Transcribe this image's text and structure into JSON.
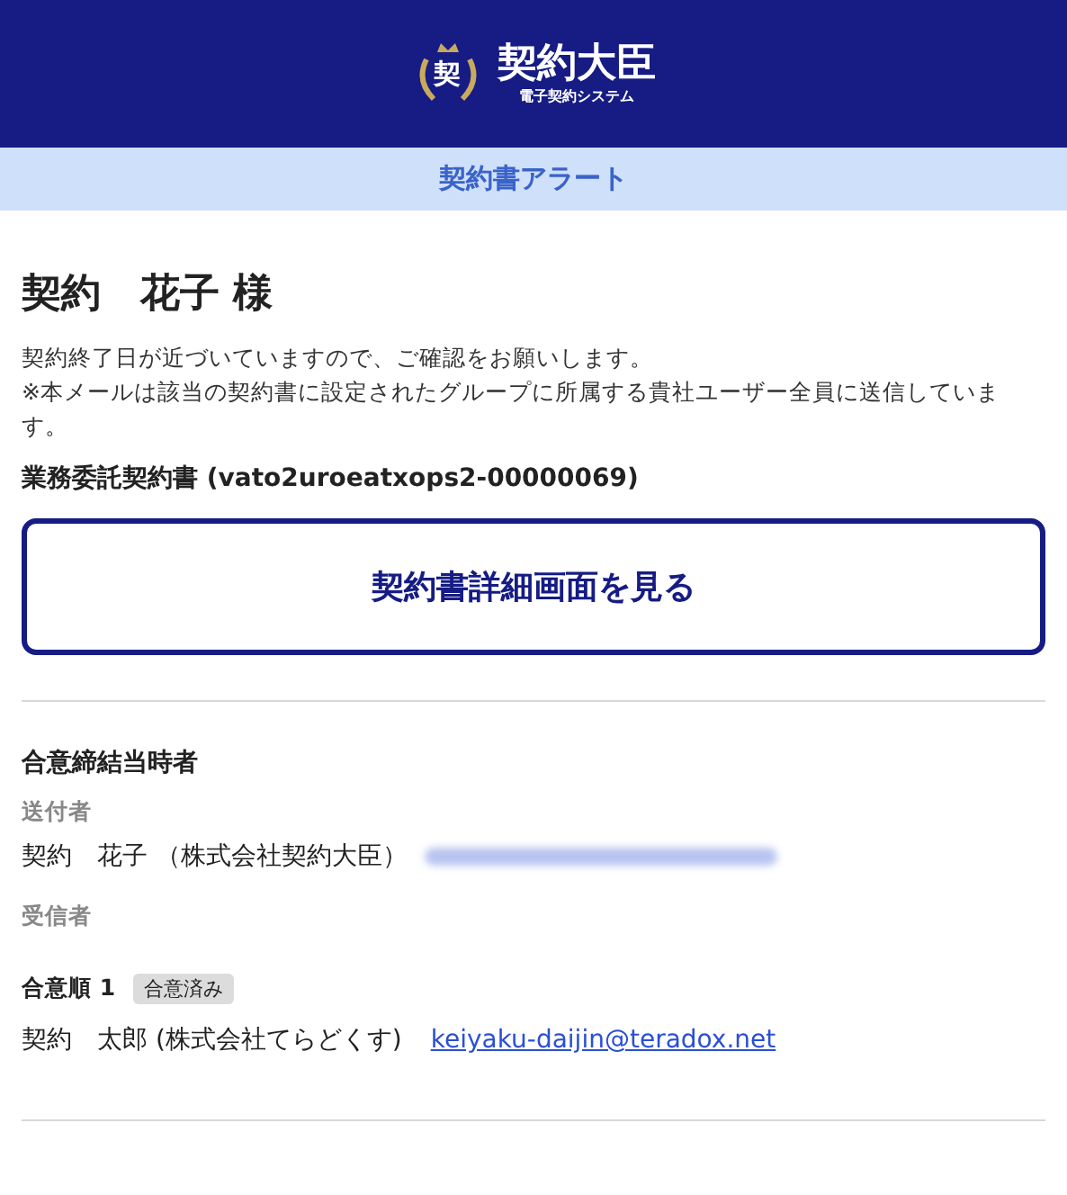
{
  "header": {
    "emblem": "契",
    "brand": "契約大臣",
    "tagline": "電子契約システム"
  },
  "alert_bar": {
    "title": "契約書アラート"
  },
  "greeting": "契約　花子 様",
  "message": [
    "契約終了日が近づいていますので、ご確認をお願いします。",
    "※本メールは該当の契約書に設定されたグループに所属する貴社ユーザー全員に送信しています。"
  ],
  "document_title": "業務委託契約書 (vato2uroeatxops2-00000069)",
  "view_button": "契約書詳細画面を見る",
  "parties": {
    "heading": "合意締結当時者",
    "sender": {
      "label": "送付者",
      "name": "契約　花子 （株式会社契約大臣）",
      "email_redacted": true
    },
    "recipients_label": "受信者",
    "recipients": [
      {
        "order": "合意順 1",
        "status": "合意済み",
        "name": "契約　太郎 (株式会社てらどくす)",
        "email": "keiyaku-daijin@teradox.net"
      }
    ]
  }
}
